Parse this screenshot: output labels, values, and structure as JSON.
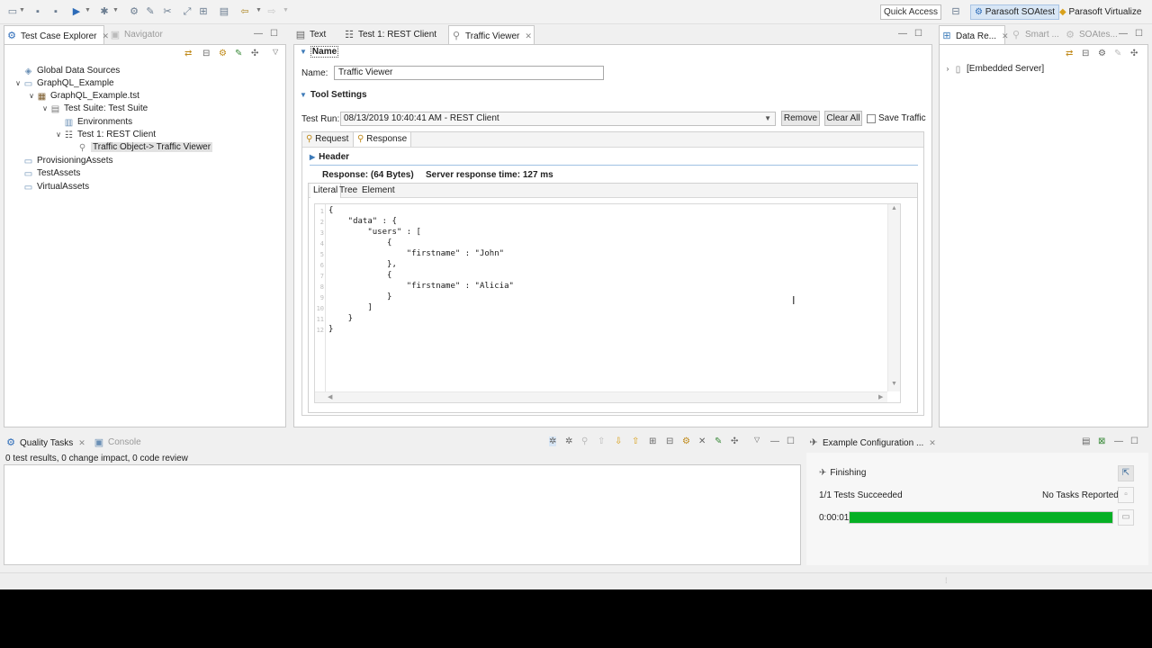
{
  "toolbar": {
    "quick_access": "Quick Access"
  },
  "perspectives": [
    {
      "label": "Parasoft SOAtest",
      "selected": true
    },
    {
      "label": "Parasoft Virtualize",
      "selected": false
    }
  ],
  "left_panel": {
    "tabs": [
      {
        "label": "Test Case Explorer",
        "active": true
      },
      {
        "label": "Navigator",
        "active": false
      }
    ],
    "tree": [
      {
        "label": "Global Data Sources",
        "icon": "folder-icon",
        "depth": 0,
        "expanded": null
      },
      {
        "label": "GraphQL_Example",
        "icon": "folder-icon",
        "depth": 0,
        "expanded": true
      },
      {
        "label": "GraphQL_Example.tst",
        "icon": "test-file-icon",
        "depth": 1,
        "expanded": true
      },
      {
        "label": "Test Suite: Test Suite",
        "icon": "test-suite-icon",
        "depth": 2,
        "expanded": true
      },
      {
        "label": "Environments",
        "icon": "environments-icon",
        "depth": 3,
        "expanded": null
      },
      {
        "label": "Test 1: REST Client",
        "icon": "rest-client-icon",
        "depth": 3,
        "expanded": true
      },
      {
        "label": "Traffic Object-> Traffic Viewer",
        "icon": "traffic-viewer-icon",
        "depth": 4,
        "expanded": null,
        "selected": true
      },
      {
        "label": "ProvisioningAssets",
        "icon": "folder-icon",
        "depth": 0,
        "expanded": null
      },
      {
        "label": "TestAssets",
        "icon": "folder-icon",
        "depth": 0,
        "expanded": null
      },
      {
        "label": "VirtualAssets",
        "icon": "folder-icon",
        "depth": 0,
        "expanded": null
      }
    ]
  },
  "editor": {
    "tabs": [
      {
        "label": "Text",
        "active": false
      },
      {
        "label": "Test 1: REST Client",
        "active": false
      },
      {
        "label": "Traffic Viewer",
        "active": true
      }
    ],
    "name_section": "Name",
    "name_label": "Name:",
    "name_value": "Traffic Viewer",
    "tool_settings": "Tool Settings",
    "test_run_label": "Test Run:",
    "test_run_value": "08/13/2019 10:40:41 AM - REST Client",
    "remove_label": "Remove",
    "clear_all_label": "Clear All",
    "save_traffic_label": "Save Traffic",
    "req_tab": "Request",
    "resp_tab": "Response",
    "header_section": "Header",
    "response_size": "Response: (64 Bytes)",
    "response_time": "Server response time: 127 ms",
    "view_tabs": [
      "Literal",
      "Tree",
      "Element"
    ],
    "code_lines": [
      "{",
      "    \"data\" : {",
      "        \"users\" : [",
      "            {",
      "                \"firstname\" : \"John\"",
      "            },",
      "            {",
      "                \"firstname\" : \"Alicia\"",
      "            }",
      "        ]",
      "    }",
      "}"
    ],
    "line_numbers": [
      "1",
      "2",
      "3",
      "4",
      "5",
      "6",
      "7",
      "8",
      "9",
      "10",
      "11",
      "12"
    ]
  },
  "right_panel": {
    "tabs": [
      {
        "label": "Data Re...",
        "active": true
      },
      {
        "label": "Smart ...",
        "active": false
      },
      {
        "label": "SOAtes...",
        "active": false
      }
    ],
    "tree_item": "[Embedded Server]"
  },
  "bottom_left": {
    "tabs": [
      {
        "label": "Quality Tasks",
        "active": true
      },
      {
        "label": "Console",
        "active": false
      }
    ],
    "summary": "0 test results, 0 change impact, 0 code review"
  },
  "bottom_right": {
    "tab": "Example Configuration ...",
    "status": "Finishing",
    "tests_succeeded": "1/1 Tests Succeeded",
    "no_tasks": "No Tasks Reported",
    "elapsed": "0:00:01",
    "progress": 1.0,
    "progress_color": "#06b025"
  }
}
